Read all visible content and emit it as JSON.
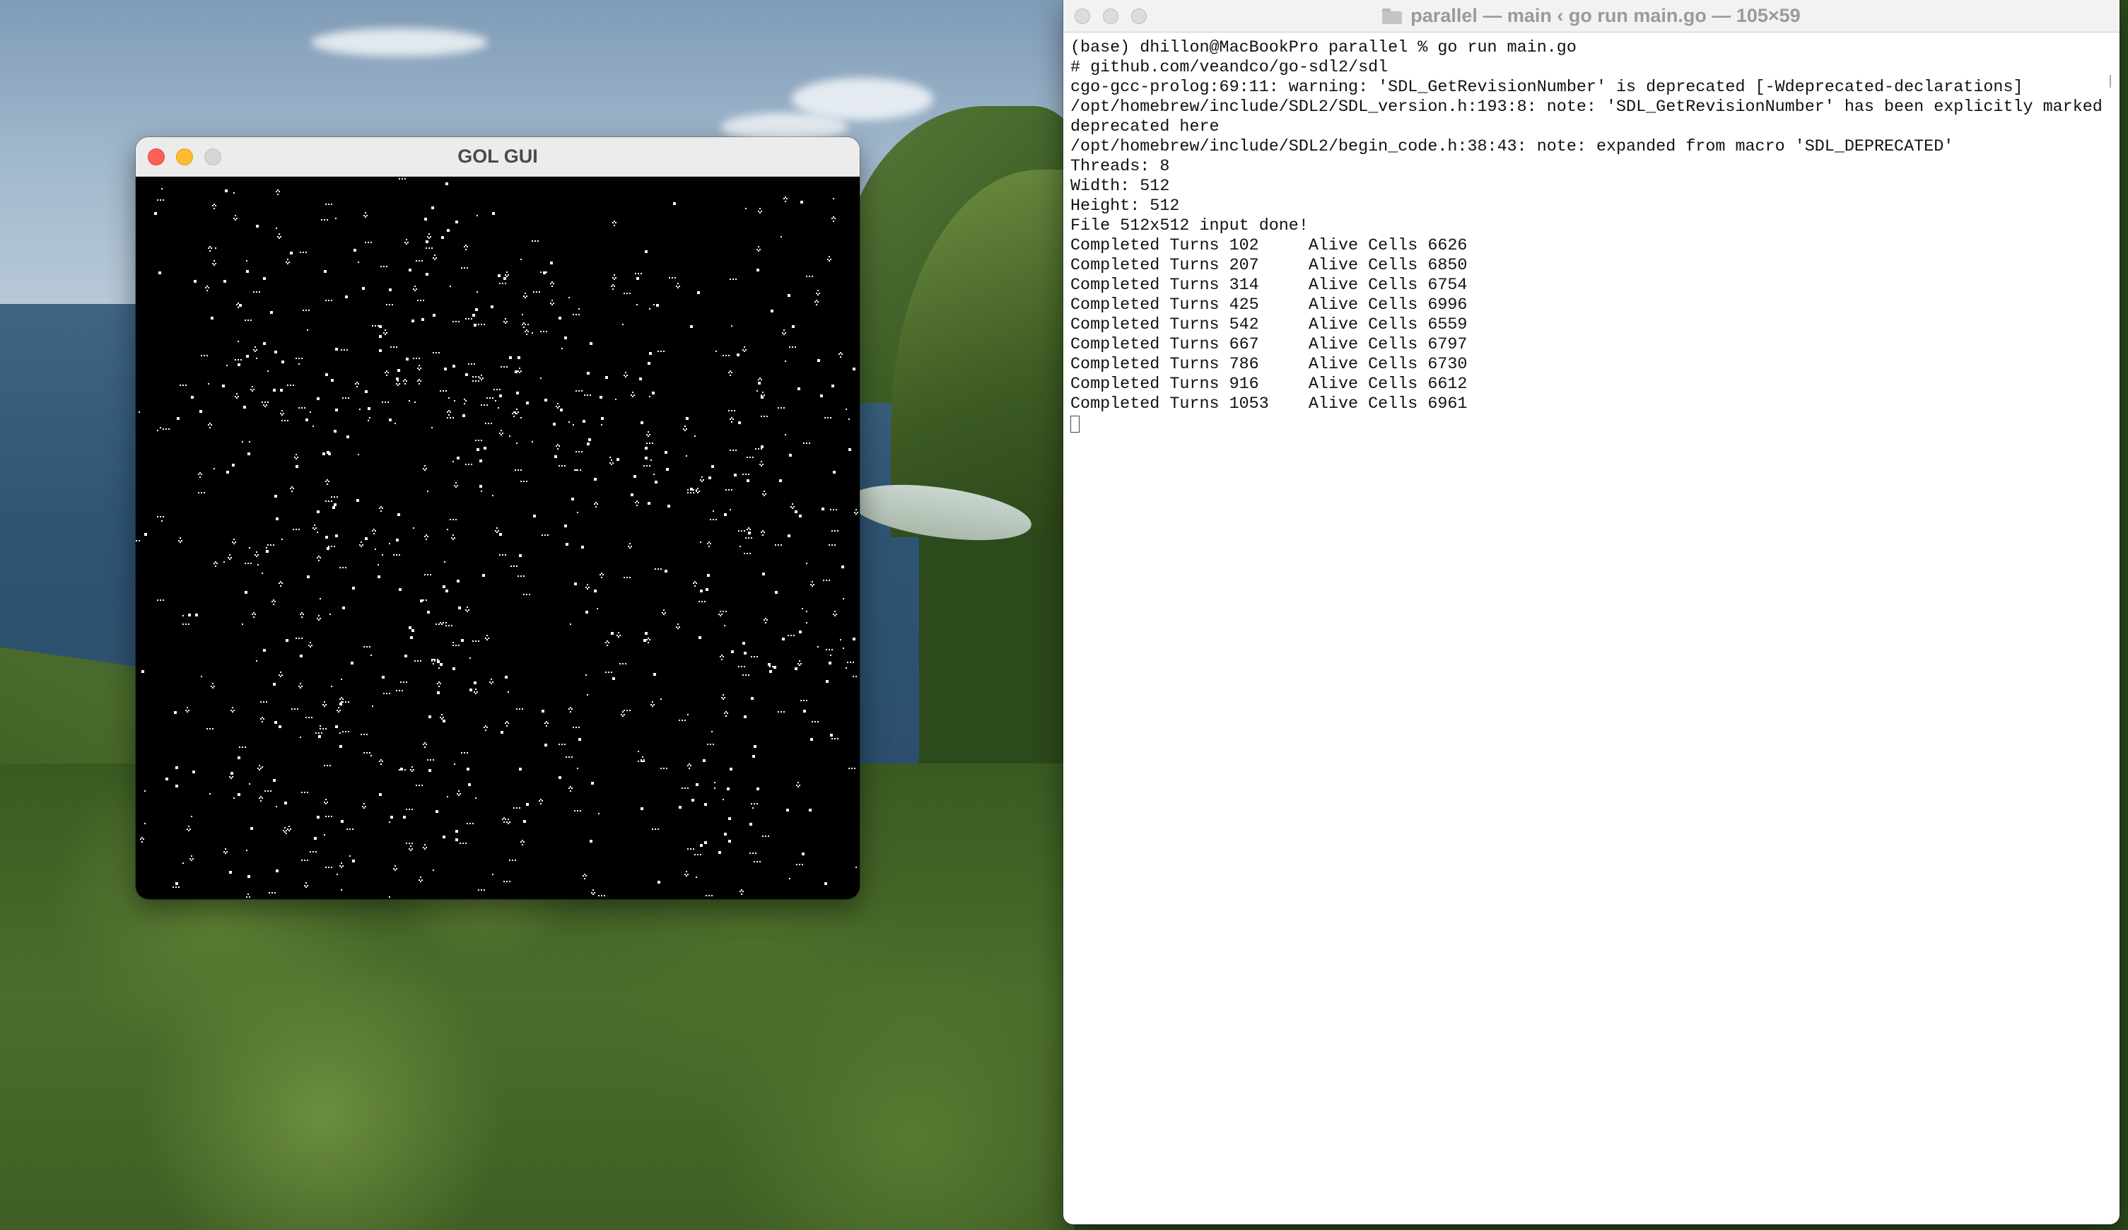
{
  "gol_window": {
    "title": "GOL GUI"
  },
  "terminal": {
    "title": "parallel — main ‹ go run main.go — 105×59",
    "lines": [
      "(base) dhillon@MacBookPro parallel % go run main.go",
      "# github.com/veandco/go-sdl2/sdl",
      "cgo-gcc-prolog:69:11: warning: 'SDL_GetRevisionNumber' is deprecated [-Wdeprecated-declarations]",
      "/opt/homebrew/include/SDL2/SDL_version.h:193:8: note: 'SDL_GetRevisionNumber' has been explicitly marked",
      "deprecated here",
      "/opt/homebrew/include/SDL2/begin_code.h:38:43: note: expanded from macro 'SDL_DEPRECATED'",
      "Threads: 8",
      "Width: 512",
      "Height: 512",
      "File 512x512 input done!",
      "Completed Turns 102     Alive Cells 6626",
      "Completed Turns 207     Alive Cells 6850",
      "Completed Turns 314     Alive Cells 6754",
      "Completed Turns 425     Alive Cells 6996",
      "Completed Turns 542     Alive Cells 6559",
      "Completed Turns 667     Alive Cells 6797",
      "Completed Turns 786     Alive Cells 6730",
      "Completed Turns 916     Alive Cells 6612",
      "Completed Turns 1053    Alive Cells 6961"
    ]
  },
  "colors": {
    "close": "#ff5f57",
    "minimize": "#febc2e",
    "gol_background": "#000000",
    "gol_cell": "#ffffff",
    "terminal_background": "#ffffff",
    "terminal_text": "#111111"
  }
}
